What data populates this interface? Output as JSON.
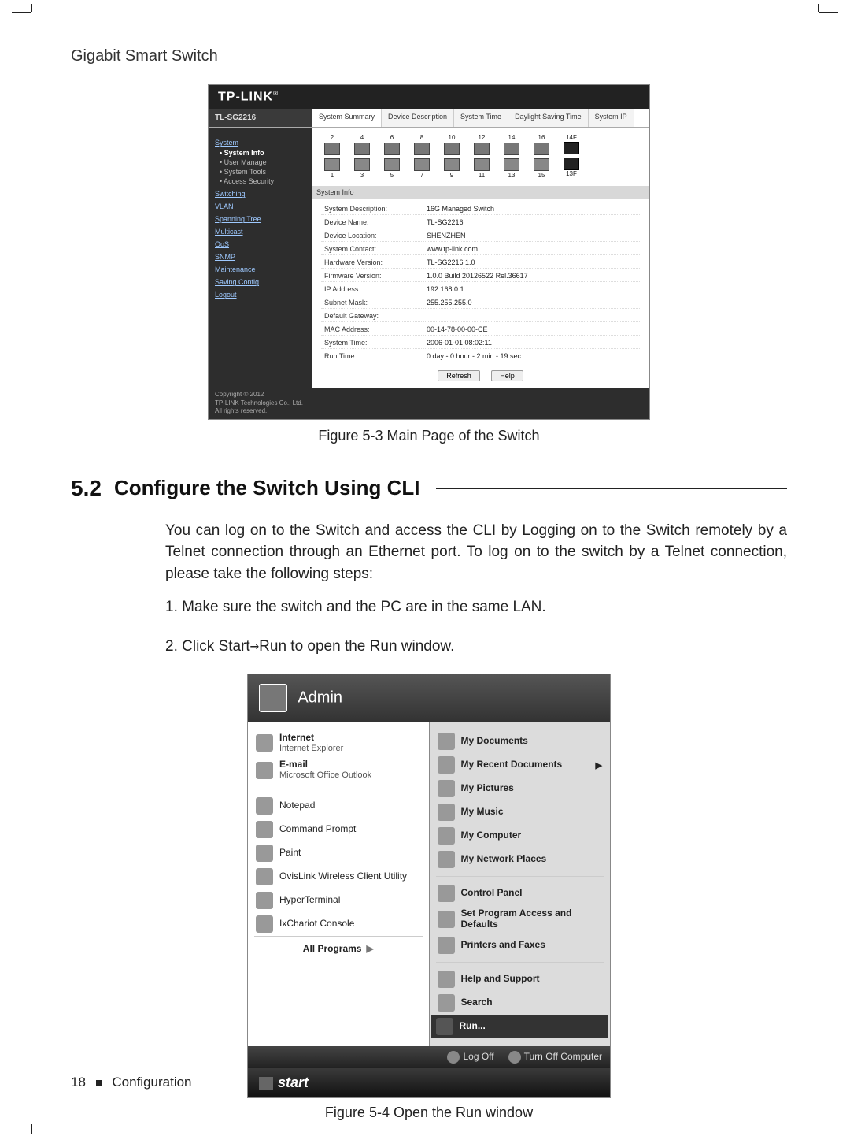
{
  "page": {
    "header": "Gigabit Smart Switch",
    "footer_page": "18",
    "footer_section": "Configuration"
  },
  "switch_ui": {
    "brand": "TP-LINK",
    "model": "TL-SG2216",
    "tabs": [
      "System Summary",
      "Device Description",
      "System Time",
      "Daylight Saving Time",
      "System IP"
    ],
    "nav": {
      "sections": [
        {
          "title": "System",
          "items": [
            "System Info",
            "User Manage",
            "System Tools",
            "Access Security"
          ],
          "active": "System Info"
        },
        {
          "title": "Switching",
          "items": []
        },
        {
          "title": "VLAN",
          "items": []
        },
        {
          "title": "Spanning Tree",
          "items": []
        },
        {
          "title": "Multicast",
          "items": []
        },
        {
          "title": "QoS",
          "items": []
        },
        {
          "title": "SNMP",
          "items": []
        },
        {
          "title": "Maintenance",
          "items": []
        },
        {
          "title": "Saving Config",
          "items": []
        },
        {
          "title": "Logout",
          "items": []
        }
      ]
    },
    "port_top": [
      "2",
      "4",
      "6",
      "8",
      "10",
      "12",
      "14",
      "16"
    ],
    "port_bottom": [
      "1",
      "3",
      "5",
      "7",
      "9",
      "11",
      "13",
      "15"
    ],
    "sfp_top": "14F",
    "sfp_bottom": "13F",
    "sysinfo_heading": "System Info",
    "summary": [
      [
        "System Description:",
        "16G Managed Switch"
      ],
      [
        "Device Name:",
        "TL-SG2216"
      ],
      [
        "Device Location:",
        "SHENZHEN"
      ],
      [
        "System Contact:",
        "www.tp-link.com"
      ],
      [
        "Hardware Version:",
        "TL-SG2216 1.0"
      ],
      [
        "Firmware Version:",
        "1.0.0 Build 20126522 Rel.36617"
      ],
      [
        "IP Address:",
        "192.168.0.1"
      ],
      [
        "Subnet Mask:",
        "255.255.255.0"
      ],
      [
        "Default Gateway:",
        ""
      ],
      [
        "MAC Address:",
        "00-14-78-00-00-CE"
      ],
      [
        "System Time:",
        "2006-01-01 08:02:11"
      ],
      [
        "Run Time:",
        "0 day - 0 hour - 2 min - 19 sec"
      ]
    ],
    "buttons": {
      "refresh": "Refresh",
      "help": "Help"
    },
    "copyright": "Copyright © 2012\nTP-LINK Technologies Co., Ltd.\nAll rights reserved."
  },
  "figcap1": "Figure 5-3  Main Page of the Switch",
  "section": {
    "num": "5.2",
    "title": "Configure the Switch Using CLI"
  },
  "para1": "You can log on to the Switch and access the CLI by Logging on to the Switch remotely by a Telnet connection through an Ethernet port. To log on to the switch by a Telnet connection, please take the following steps:",
  "step1": "1. Make sure the switch and the PC are in the same LAN.",
  "step2a": "2. Click Start",
  "step2b": "Run to open the Run window.",
  "startmenu": {
    "user": "Admin",
    "left": [
      {
        "title": "Internet",
        "sub": "Internet Explorer",
        "bold": true
      },
      {
        "title": "E-mail",
        "sub": "Microsoft Office Outlook",
        "bold": true
      },
      {
        "title": "Notepad"
      },
      {
        "title": "Command Prompt"
      },
      {
        "title": "Paint"
      },
      {
        "title": "OvisLink Wireless Client Utility"
      },
      {
        "title": "HyperTerminal"
      },
      {
        "title": "IxChariot Console"
      }
    ],
    "all_programs": "All Programs",
    "right": [
      {
        "title": "My Documents"
      },
      {
        "title": "My Recent Documents",
        "arrow": true
      },
      {
        "title": "My Pictures"
      },
      {
        "title": "My Music"
      },
      {
        "title": "My Computer"
      },
      {
        "title": "My Network Places"
      },
      {
        "sep": true
      },
      {
        "title": "Control Panel"
      },
      {
        "title": "Set Program Access and Defaults"
      },
      {
        "title": "Printers and Faxes"
      },
      {
        "sep": true
      },
      {
        "title": "Help and Support"
      },
      {
        "title": "Search"
      },
      {
        "title": "Run...",
        "highlight": true
      }
    ],
    "logoff": "Log Off",
    "turnoff": "Turn Off Computer",
    "start": "start"
  },
  "figcap2": "Figure 5-4  Open the Run window"
}
